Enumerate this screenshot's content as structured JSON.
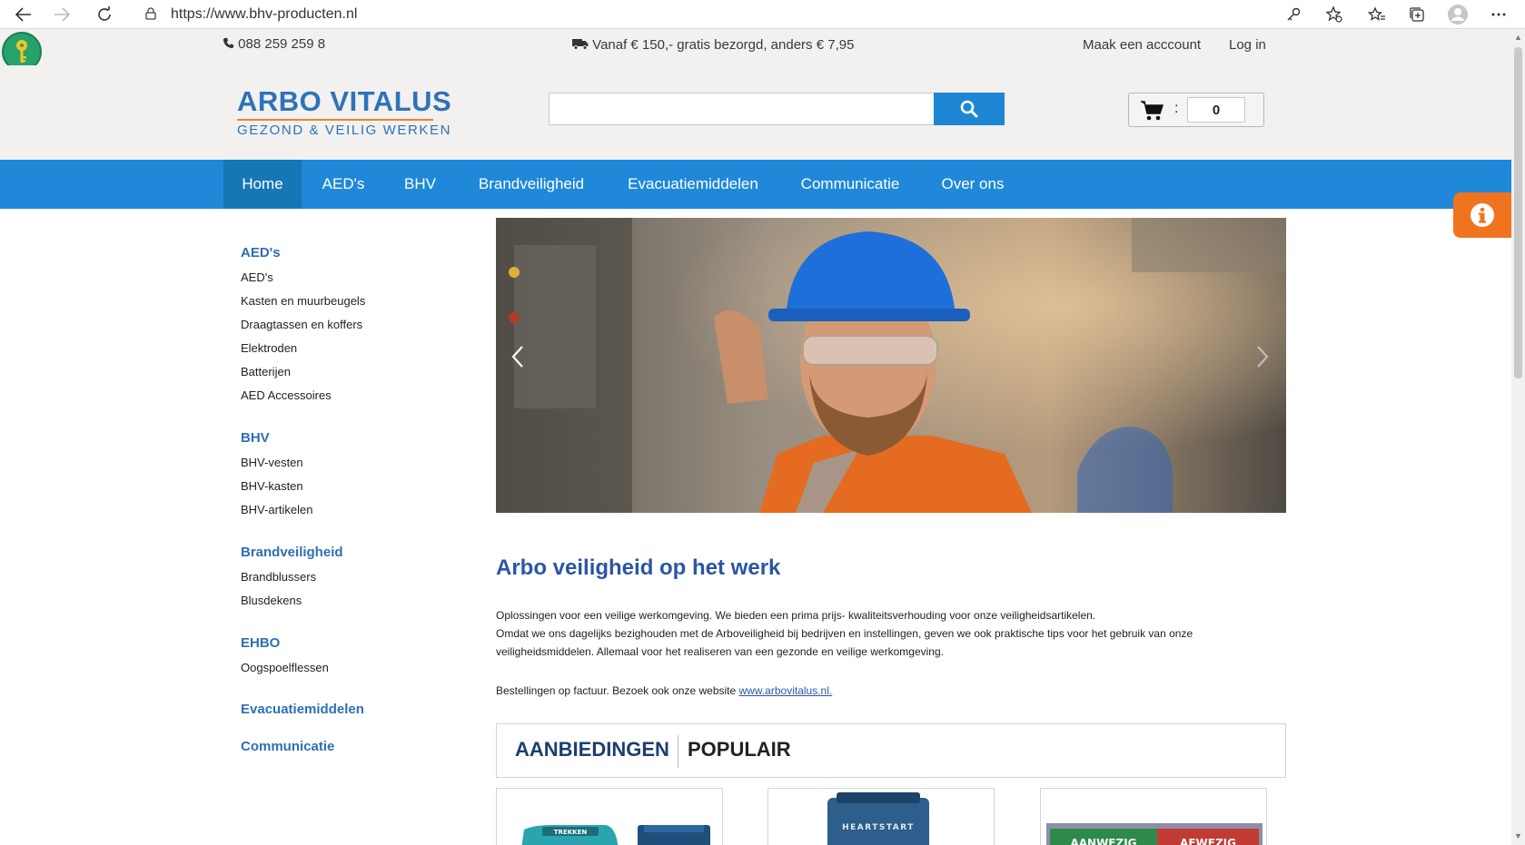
{
  "browser": {
    "url": "https://www.bhv-producten.nl"
  },
  "topbar": {
    "phone": "088 259 259 8",
    "shipping": "Vanaf € 150,- gratis bezorgd, anders € 7,95",
    "create_account": "Maak een acccount",
    "login": "Log in"
  },
  "logo": {
    "title": "ARBO VITALUS",
    "subtitle": "GEZOND & VEILIG WERKEN"
  },
  "search": {
    "placeholder": ""
  },
  "cart": {
    "separator": ":",
    "count": "0"
  },
  "nav": {
    "items": [
      "Home",
      "AED's",
      "BHV",
      "Brandveiligheid",
      "Evacuatiemiddelen",
      "Communicatie",
      "Over ons"
    ],
    "active": "Home"
  },
  "sidebar": {
    "aed_heading": "AED's",
    "aed_items": [
      "AED's",
      "Kasten en muurbeugels",
      "Draagtassen en koffers",
      "Elektroden",
      "Batterijen",
      "AED Accessoires"
    ],
    "bhv_heading": "BHV",
    "bhv_items": [
      "BHV-vesten",
      "BHV-kasten",
      "BHV-artikelen"
    ],
    "brand_heading": "Brandveiligheid",
    "brand_items": [
      "Brandblussers",
      "Blusdekens"
    ],
    "ehbo_heading": "EHBO",
    "ehbo_items": [
      "Oogspoelflessen"
    ],
    "evac_heading": "Evacuatiemiddelen",
    "comm_heading": "Communicatie"
  },
  "content": {
    "title": "Arbo veiligheid op het werk",
    "para1_line1": "Oplossingen voor een veilige werkomgeving. We bieden een prima prijs- kwaliteitsverhouding voor onze veiligheidsartikelen.",
    "para1_line2": "Omdat we ons dagelijks bezighouden met de Arboveiligheid bij bedrijven en instellingen, geven we ook praktische tips voor het gebruik van onze",
    "para1_line3": "veiligheidsmiddelen. Allemaal voor het realiseren van een gezonde en veilige werkomgeving.",
    "para2_text": "Bestellingen op factuur. Bezoek ook onze website ",
    "para2_link": "www.arbovitalus.nl."
  },
  "tabs": {
    "offers": "AANBIEDINGEN",
    "popular": "POPULAIR"
  },
  "products": {
    "p1_label": "TREKKEN",
    "p2_label": "HEARTSTART",
    "p3_left": "AANWEZIG",
    "p3_right": "AFWEZIG"
  },
  "colors": {
    "brand_blue": "#2e73b8",
    "nav_blue": "#1f88d8",
    "nav_active": "#1577b5",
    "accent_orange": "#f07320",
    "heading_blue": "#2b56a6"
  },
  "icons": [
    "back-icon",
    "forward-icon",
    "reload-icon",
    "lock-icon",
    "key-icon",
    "add-favorite-icon",
    "favorites-icon",
    "collections-icon",
    "profile-icon",
    "more-icon",
    "phone-icon",
    "truck-icon",
    "search-icon",
    "cart-icon",
    "info-icon",
    "chevron-left-icon",
    "chevron-right-icon"
  ]
}
